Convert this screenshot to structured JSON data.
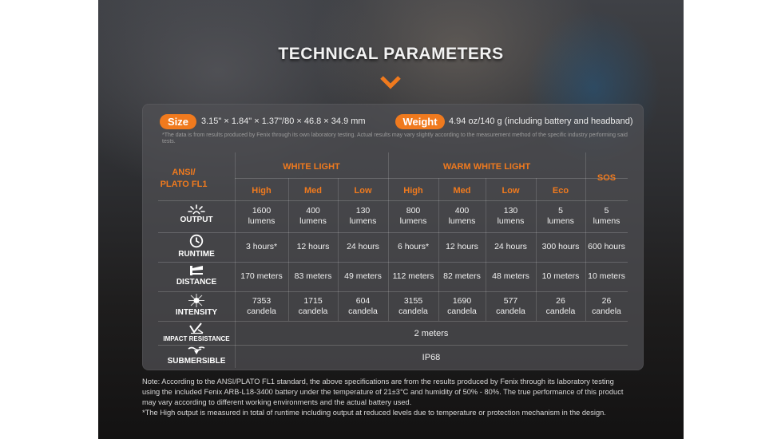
{
  "title": "TECHNICAL PARAMETERS",
  "colors": {
    "accent": "#f07a1e",
    "card": "#4f5054"
  },
  "size": {
    "label": "Size",
    "value": "3.15\" × 1.84\" × 1.37\"/80 × 46.8 × 34.9 mm"
  },
  "weight": {
    "label": "Weight",
    "value": "4.94 oz/140 g (including battery and headband)"
  },
  "disclaimer": "*The data is from results produced by Fenix through its own laboratory testing. Actual results may vary slightly according to the measurement method of the specific industry performing said tests.",
  "table": {
    "standard_label": [
      "ANSI/",
      "PLATO FL1"
    ],
    "groups": [
      "WHITE LIGHT",
      "WARM WHITE LIGHT",
      "SOS"
    ],
    "modes": [
      "High",
      "Med",
      "Low",
      "High",
      "Med",
      "Low",
      "Eco"
    ],
    "rows": [
      {
        "label": "OUTPUT",
        "icon": "burst-icon",
        "values": [
          [
            "1600",
            "lumens"
          ],
          [
            "400",
            "lumens"
          ],
          [
            "130",
            "lumens"
          ],
          [
            "800",
            "lumens"
          ],
          [
            "400",
            "lumens"
          ],
          [
            "130",
            "lumens"
          ],
          [
            "5",
            "lumens"
          ],
          [
            "5",
            "lumens"
          ]
        ]
      },
      {
        "label": "RUNTIME",
        "icon": "clock-icon",
        "values": [
          [
            "3 hours*"
          ],
          [
            "12 hours"
          ],
          [
            "24 hours"
          ],
          [
            "6 hours*"
          ],
          [
            "12 hours"
          ],
          [
            "24 hours"
          ],
          [
            "300 hours"
          ],
          [
            "600 hours"
          ]
        ]
      },
      {
        "label": "DISTANCE",
        "icon": "beam-icon",
        "values": [
          [
            "170 meters"
          ],
          [
            "83 meters"
          ],
          [
            "49 meters"
          ],
          [
            "112 meters"
          ],
          [
            "82 meters"
          ],
          [
            "48 meters"
          ],
          [
            "10 meters"
          ],
          [
            "10 meters"
          ]
        ]
      },
      {
        "label": "INTENSITY",
        "icon": "intensity-icon",
        "values": [
          [
            "7353",
            "candela"
          ],
          [
            "1715",
            "candela"
          ],
          [
            "604",
            "candela"
          ],
          [
            "3155",
            "candela"
          ],
          [
            "1690",
            "candela"
          ],
          [
            "577",
            "candela"
          ],
          [
            "26",
            "candela"
          ],
          [
            "26",
            "candela"
          ]
        ]
      }
    ],
    "impact": {
      "label": "IMPACT RESISTANCE",
      "icon": "impact-icon",
      "value": "2 meters"
    },
    "submersible": {
      "label": "SUBMERSIBLE",
      "icon": "waterproof-icon",
      "value": "IP68"
    }
  },
  "notes": [
    "Note: According to the ANSI/PLATO FL1 standard, the above specifications are from the results produced by Fenix through its laboratory testing",
    "using the included Fenix ARB-L18-3400 battery under the temperature of 21±3°C and humidity of 50% - 80%. The true performance of this product",
    "may vary according to different working environments and the actual battery used.",
    "*The High output is measured in total of runtime including output at reduced levels due to temperature or protection mechanism in the design."
  ]
}
